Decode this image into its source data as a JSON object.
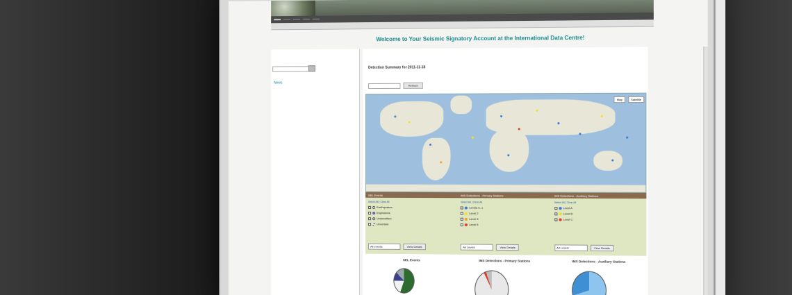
{
  "welcome_title": "Welcome to Your Seismic Signatory Account at the International Data Centre!",
  "news_title": "News",
  "summary": {
    "label": "Detection Summary for",
    "date": "2011-11-18"
  },
  "date_button": "Refresh",
  "map_controls": {
    "map": "Map",
    "satellite": "Satellite"
  },
  "legend_headers": [
    "SEL Events",
    "IMS Detections - Primary Stations",
    "IMS Detections - Auxiliary Stations"
  ],
  "legend_cols": [
    {
      "select": "Select All | Clear All",
      "items": [
        {
          "label": "Earthquakes",
          "color": "#ffffff"
        },
        {
          "label": "Explosions",
          "color": "#6b5fae"
        },
        {
          "label": "Unidentified",
          "color": "#d8d8d8"
        },
        {
          "label": "Uncertain",
          "color": "#ffffff"
        }
      ],
      "dropdown": "All events",
      "button": "View Details"
    },
    {
      "select": "Select All | Clear All",
      "items": [
        {
          "label": "Levels 0, 1",
          "color": "#3a7bd5"
        },
        {
          "label": "Level 2",
          "color": "#f0e02a"
        },
        {
          "label": "Level 3",
          "color": "#f0a02a"
        },
        {
          "label": "Level 5",
          "color": "#e23c2a"
        }
      ],
      "dropdown": "All Levels",
      "button": "View Details"
    },
    {
      "select": "Select All | Clear All",
      "items": [
        {
          "label": "Level A",
          "color": "#3a7bd5"
        },
        {
          "label": "Level B",
          "color": "#f0e02a"
        },
        {
          "label": "Level C",
          "color": "#e23c2a"
        }
      ],
      "dropdown": "All Levels",
      "button": "View Details"
    }
  ],
  "chart_titles": [
    "SEL Events",
    "IMS Detections - Primary Stations",
    "IMS Detections - Auxiliary Stations"
  ],
  "colors": {
    "accent": "#1c8a8a",
    "legend_bg": "#dfe6c2",
    "legend_header": "#8a6a4e",
    "map_water": "#9ec0de"
  }
}
